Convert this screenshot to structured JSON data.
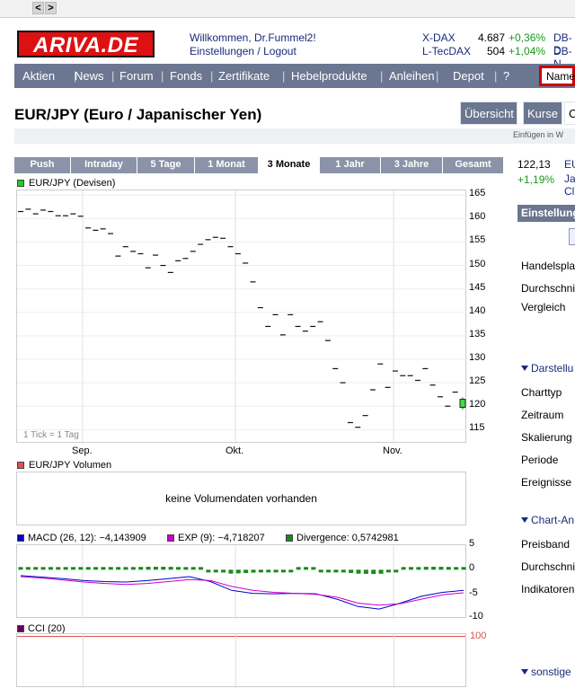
{
  "browser": {
    "back": "<",
    "forward": ">"
  },
  "header": {
    "logo": "ARIVA.DE",
    "welcome": "Willkommen, Dr.Fummel2!",
    "settings": "Einstellungen",
    "sep": "/",
    "logout": "Logout",
    "indices": [
      {
        "name": "X-DAX",
        "value": "4.687",
        "change": "+0,36%",
        "extra": "DB-D"
      },
      {
        "name": "L-TecDAX",
        "value": "504",
        "change": "+1,04%",
        "extra": "DB-N"
      }
    ]
  },
  "menu": {
    "items": [
      "Aktien",
      "News",
      "Forum",
      "Fonds",
      "Zertifikate",
      "Hebelprodukte",
      "Anleihen",
      "Depot",
      "?"
    ],
    "search_placeholder": "Name"
  },
  "page": {
    "title": "EUR/JPY (Euro / Japanischer Yen)",
    "buttons": [
      "Übersicht",
      "Kurse",
      "C"
    ],
    "insert_text": "Einfügen in W"
  },
  "tabs": [
    "Push",
    "Intraday",
    "5 Tage",
    "1 Monat",
    "3 Monate",
    "1 Jahr",
    "3 Jahre",
    "Gesamt"
  ],
  "active_tab": "3 Monate",
  "quote": {
    "price": "122,13",
    "change": "+1,19%",
    "side1": "EU",
    "side2": "Ja",
    "side3": "Cl"
  },
  "price_chart": {
    "legend": "EUR/JPY (Devisen)",
    "tick_note": "1 Tick = 1 Tag",
    "colors": {
      "legend_box": "#22cc22",
      "last_candle": "#44dd44"
    }
  },
  "volume": {
    "legend": "EUR/JPY Volumen",
    "message": "keine Volumendaten vorhanden",
    "legend_color": "#e05050"
  },
  "macd": {
    "macd_label": "MACD (26, 12): −4,143909",
    "exp_label": "EXP (9): −4,718207",
    "div_label": "Divergence: 0,5742981",
    "colors": {
      "macd": "#0000cc",
      "exp": "#cc00cc",
      "divergence": "#1a8a1a"
    }
  },
  "cci": {
    "label": "CCI (20)",
    "level": "100",
    "color": "#660066",
    "line_color": "#e05050"
  },
  "sidebar": {
    "header": "Einstellung",
    "rows1": [
      "Handelspla",
      "Durchschni",
      "Vergleich"
    ],
    "section2": "Darstellu",
    "rows2": [
      "Charttyp",
      "Zeitraum",
      "Skalierung",
      "Periode",
      "Ereignisse"
    ],
    "section3": "Chart-An",
    "rows3": [
      "Preisband",
      "Durchschni",
      "Indikatoren"
    ],
    "section4": "sonstige"
  },
  "chart_data": [
    {
      "type": "scatter",
      "title": "EUR/JPY (Devisen)",
      "x_labels": [
        "Sep.",
        "Okt.",
        "Nov."
      ],
      "y_ticks": [
        115,
        120,
        125,
        130,
        135,
        140,
        145,
        150,
        155,
        160,
        165
      ],
      "ylim": [
        112,
        166
      ],
      "values": [
        161.5,
        162.0,
        161.0,
        161.8,
        161.5,
        160.6,
        160.6,
        161.0,
        160.5,
        158.0,
        157.5,
        157.8,
        156.8,
        152.0,
        154.0,
        153.0,
        152.5,
        149.5,
        152.2,
        150.0,
        148.5,
        151.0,
        151.5,
        153.0,
        154.5,
        155.5,
        156.0,
        155.8,
        154.0,
        152.5,
        150.5,
        146.5,
        141.0,
        137.0,
        139.5,
        135.2,
        139.5,
        137.0,
        136.0,
        137.0,
        138.0,
        134.0,
        128.0,
        125.0,
        116.5,
        115.5,
        118.0,
        123.5,
        129.0,
        124.0,
        127.5,
        126.5,
        126.5,
        125.5,
        128.0,
        124.5,
        122.0,
        120.0,
        123.0,
        120.7
      ]
    },
    {
      "type": "line",
      "title": "MACD (26, 12)",
      "y_ticks": [
        5,
        0,
        -5,
        -10
      ],
      "ylim": [
        -10,
        5
      ],
      "series": [
        {
          "name": "MACD (26, 12)",
          "values": [
            -1.2,
            -1.5,
            -1.8,
            -2.2,
            -2.4,
            -2.5,
            -2.2,
            -1.8,
            -1.4,
            -2.4,
            -4.2,
            -4.8,
            -4.9,
            -4.8,
            -4.9,
            -6.0,
            -7.5,
            -8.0,
            -6.8,
            -5.4,
            -4.6,
            -4.2
          ]
        },
        {
          "name": "EXP (9)",
          "values": [
            -1.4,
            -1.7,
            -2.1,
            -2.5,
            -2.8,
            -3.0,
            -2.8,
            -2.4,
            -2.0,
            -2.2,
            -3.4,
            -4.2,
            -4.6,
            -4.8,
            -5.0,
            -5.6,
            -6.8,
            -7.2,
            -6.9,
            -6.0,
            -5.1,
            -4.7
          ]
        },
        {
          "name": "Divergence",
          "values": [
            0.3,
            0.2,
            0.3,
            0.3,
            0.4,
            0.5,
            0.6,
            0.6,
            0.5,
            -0.2,
            -0.8,
            -0.6,
            -0.3,
            0.0,
            0.1,
            -0.4,
            -0.8,
            -0.9,
            0.1,
            0.6,
            0.6,
            0.5
          ]
        }
      ]
    }
  ]
}
